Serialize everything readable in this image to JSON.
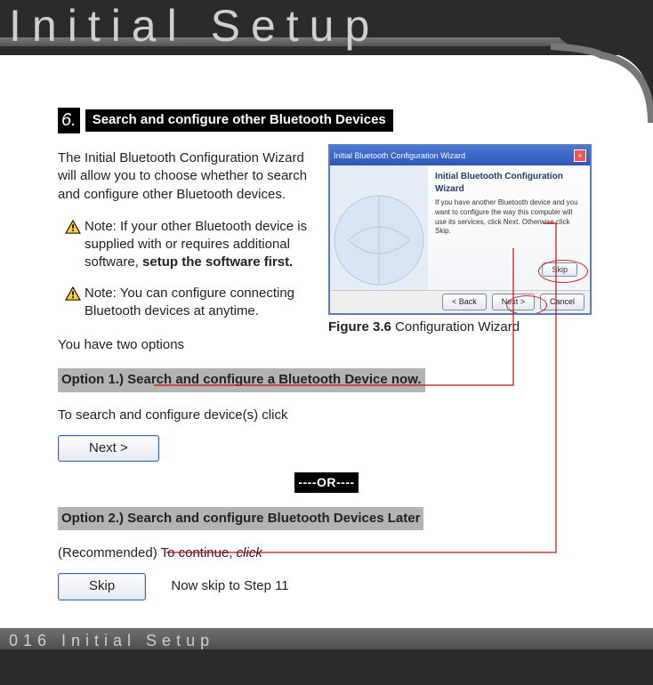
{
  "header": {
    "title": "Initial Setup"
  },
  "footer": {
    "text": "016 Initial Setup"
  },
  "step": {
    "number": "6.",
    "heading": "Search and configure other Bluetooth Devices",
    "intro": "The Initial Bluetooth Configuration Wizard will allow you to choose whether to search and configure other Bluetooth devices.",
    "note1_prefix": "Note: If your other Bluetooth device is supplied with or requires additional software, ",
    "note1_bold": "setup the software first.",
    "note2": "Note: You can configure connecting Bluetooth devices at anytime.",
    "two_options": "You have two options"
  },
  "figure": {
    "label": "Figure 3.6",
    "caption": " Configuration Wizard",
    "win_title": "Initial Bluetooth Configuration Wizard",
    "body_heading": "Initial Bluetooth Configuration Wizard",
    "body_para": "If you have another Bluetooth device and you want to configure the way this computer will use its services, click Next. Otherwise click Skip.",
    "btn_skip": "Skip",
    "btn_back": "< Back",
    "btn_next": "Next >",
    "btn_cancel": "Cancel"
  },
  "option1": {
    "heading": "Option 1.) Search and configure a Bluetooth Device now.",
    "instruction": "To search and configure device(s) click",
    "button": "Next >"
  },
  "divider": "----OR----",
  "option2": {
    "heading": "Option 2.) Search and configure Bluetooth Devices Later",
    "instruction_pre": "(Recommended) To continue, ",
    "instruction_ital": "click",
    "button": "Skip",
    "after_button": "Now skip to Step 11"
  }
}
